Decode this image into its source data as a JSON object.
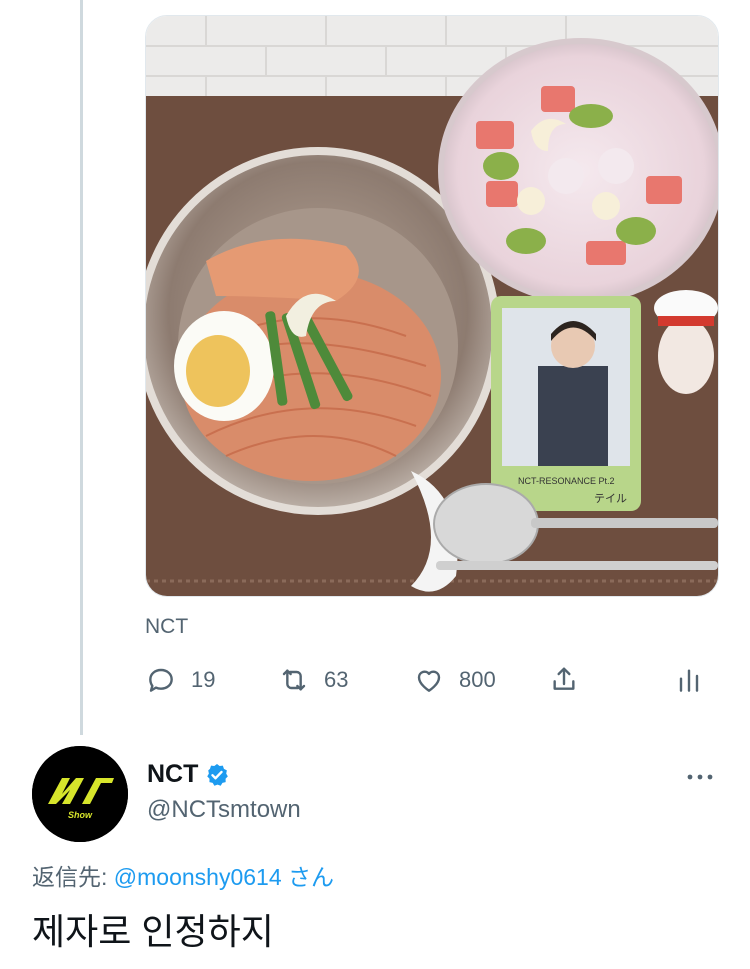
{
  "media": {
    "photocard_title": "NCT-RESONANCE Pt.2",
    "photocard_member": "テイル"
  },
  "source_label": "NCT",
  "actions": {
    "reply_count": "19",
    "retweet_count": "63",
    "like_count": "800"
  },
  "author": {
    "display_name": "NCT",
    "handle": "@NCTsmtown",
    "avatar_text": "Show",
    "verified": true
  },
  "reply": {
    "prefix": "返信先: ",
    "mention": "@moonshy0614",
    "suffix": " さん"
  },
  "tweet_text": "제자로 인정하지",
  "colors": {
    "link": "#1d9bf0",
    "secondary_text": "#536471",
    "thread_line": "#cfd9de"
  }
}
